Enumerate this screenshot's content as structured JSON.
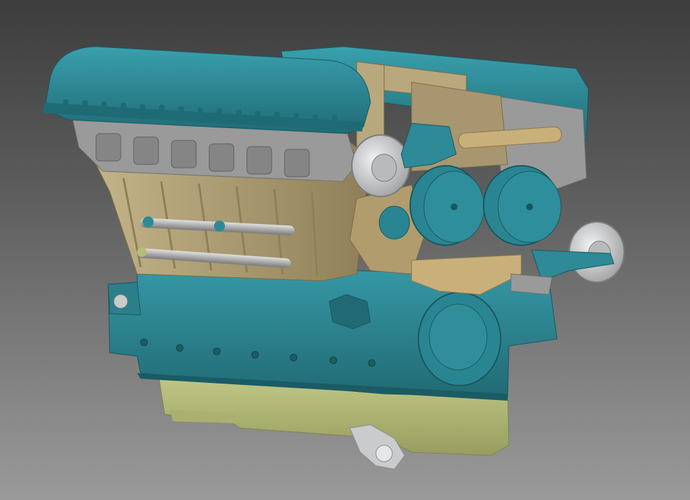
{
  "viewport": {
    "background_top": "#3d3d3d",
    "background_bottom": "#9a9a9a"
  },
  "model": {
    "part_colors": {
      "rocker_cover": "#2d8a96",
      "rocker_cover_shadow": "#1f6b75",
      "crankcase": "#2e8794",
      "crankcase_shadow": "#216a74",
      "cylinder_block": "#b9a87d",
      "cylinder_block_shadow": "#8f7f58",
      "cylinder_head": "#9c9c9c",
      "oil_pan": "#b6bd7c",
      "oil_pan_shadow": "#8d9457",
      "pulley_silver": "#d4d6d8",
      "tube_grey": "#a8a8a8",
      "accessory_gold": "#c9b07a"
    },
    "icons": [
      "rocker-cover-left-icon",
      "rocker-cover-right-icon",
      "cylinder-bank-icon",
      "crankcase-icon",
      "oil-pan-icon",
      "pulley-icon",
      "flywheel-cover-icon"
    ]
  }
}
